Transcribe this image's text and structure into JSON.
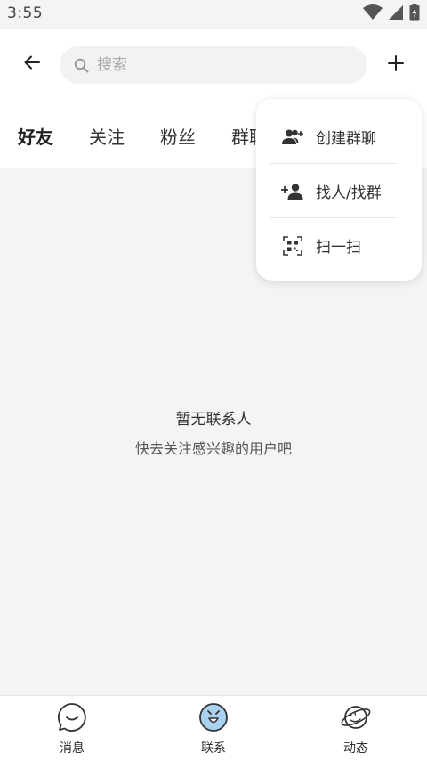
{
  "status_bar": {
    "time": "3:55",
    "icons": [
      "wifi-icon",
      "cellular-icon",
      "battery-charging-icon"
    ]
  },
  "header": {
    "back_icon": "arrow-left-icon",
    "search": {
      "placeholder": "搜索",
      "value": "",
      "icon": "search-icon"
    },
    "add_icon": "plus-icon"
  },
  "tabs": [
    {
      "label": "好友",
      "active": true
    },
    {
      "label": "关注",
      "active": false
    },
    {
      "label": "粉丝",
      "active": false
    },
    {
      "label": "群聊",
      "active": false
    }
  ],
  "popup_menu": {
    "items": [
      {
        "label": "创建群聊",
        "icon": "group-add-icon"
      },
      {
        "label": "找人/找群",
        "icon": "person-add-icon"
      },
      {
        "label": "扫一扫",
        "icon": "qr-scan-icon"
      }
    ]
  },
  "empty_state": {
    "title": "暂无联系人",
    "subtitle": "快去关注感兴趣的用户吧"
  },
  "bottom_nav": {
    "items": [
      {
        "label": "消息",
        "icon": "message-bubble-icon",
        "active": false
      },
      {
        "label": "联系",
        "icon": "contacts-face-icon",
        "active": true
      },
      {
        "label": "动态",
        "icon": "planet-icon",
        "active": false
      }
    ]
  },
  "colors": {
    "background": "#f4f4f4",
    "surface": "#ffffff",
    "search_bg": "#f2f2f2",
    "active_icon_bg": "#a9d2f0",
    "text_primary": "#222222",
    "text_secondary": "#555555",
    "placeholder": "#a8a8a8"
  }
}
